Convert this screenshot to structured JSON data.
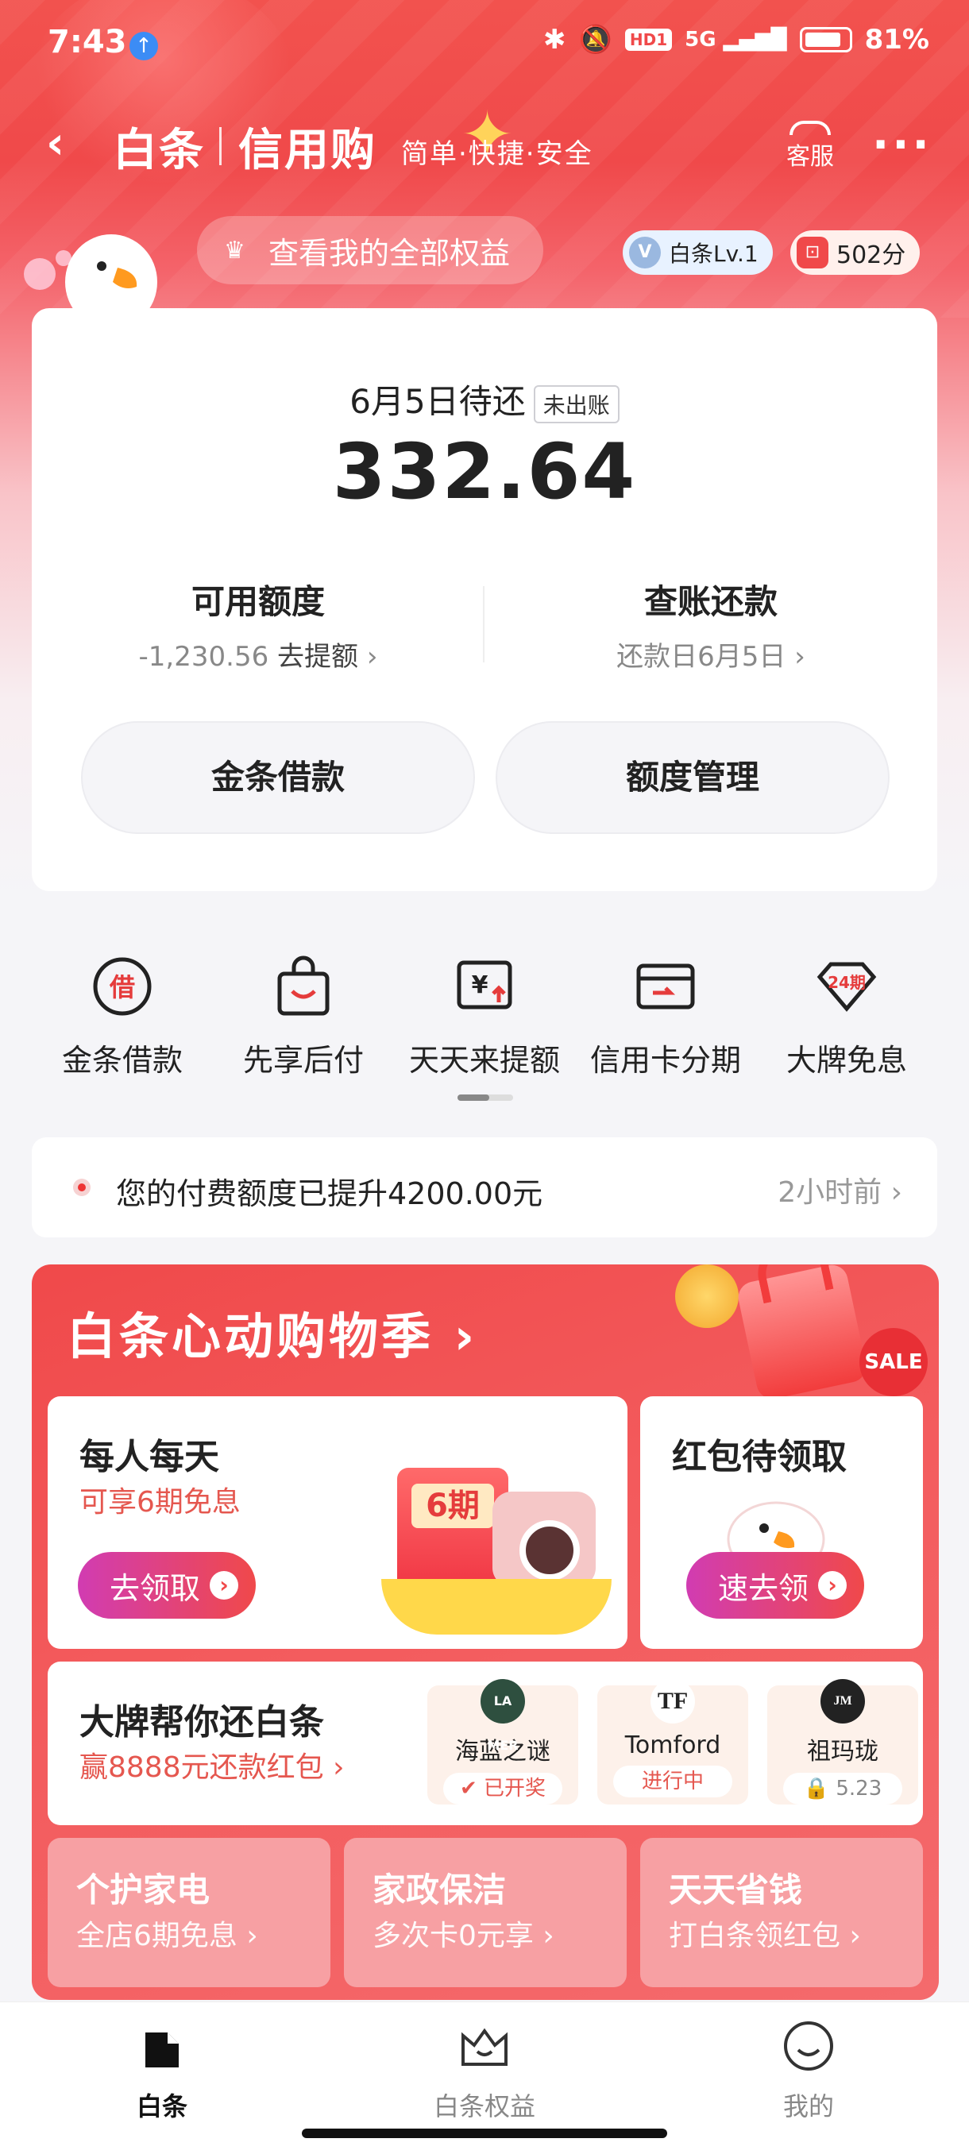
{
  "status_bar": {
    "time": "7:43",
    "hd_label": "HD1",
    "network": "5G",
    "battery": "81%"
  },
  "nav": {
    "back_icon": "chevron-left-icon",
    "brand": "白条",
    "brand2": "信用购",
    "slogan": "简单·快捷·安全",
    "service": "客服",
    "more": "···"
  },
  "benefits": {
    "button": "查看我的全部权益",
    "level": "白条Lv.1",
    "score": "502分"
  },
  "bill": {
    "due_label": "6月5日待还",
    "status_tag": "未出账",
    "amount": "332.64",
    "available": {
      "title": "可用额度",
      "value": "-1,230.56",
      "action": "去提额"
    },
    "repay": {
      "title": "查账还款",
      "date": "还款日6月5日"
    },
    "btn_loan": "金条借款",
    "btn_limit": "额度管理"
  },
  "quick_actions": [
    {
      "label": "金条借款",
      "icon": "borrow-icon"
    },
    {
      "label": "先享后付",
      "icon": "shopping-bag-icon"
    },
    {
      "label": "天天来提额",
      "icon": "yuan-up-icon"
    },
    {
      "label": "信用卡分期",
      "icon": "credit-card-icon"
    },
    {
      "label": "大牌免息",
      "icon": "24-installment-icon"
    }
  ],
  "notice": {
    "text": "您的付费额度已提升4200.00元",
    "time": "2小时前"
  },
  "promo": {
    "title": "白条心动购物季",
    "sale_badge": "SALE",
    "card1": {
      "title": "每人每天",
      "subtitle": "可享6期免息",
      "button": "去领取",
      "tag": "6期"
    },
    "card2": {
      "title": "红包待领取",
      "button": "速去领"
    },
    "card3": {
      "title": "大牌帮你还白条",
      "subtitle": "赢8888元还款红包",
      "brands": [
        {
          "logo": "LA MER",
          "name": "海蓝之谜",
          "status": "已开奖"
        },
        {
          "logo": "TF",
          "name": "Tomford",
          "status": "进行中"
        },
        {
          "logo": "JM",
          "name": "祖玛珑",
          "status": "5.23"
        }
      ]
    },
    "small_cards": [
      {
        "title": "个护家电",
        "subtitle": "全店6期免息"
      },
      {
        "title": "家政保洁",
        "subtitle": "多次卡0元享"
      },
      {
        "title": "天天省钱",
        "subtitle": "打白条领红包"
      }
    ]
  },
  "tabbar": [
    {
      "label": "白条",
      "icon": "baitiao-icon",
      "active": true
    },
    {
      "label": "白条权益",
      "icon": "crown-icon",
      "active": false
    },
    {
      "label": "我的",
      "icon": "smile-icon",
      "active": false
    }
  ]
}
